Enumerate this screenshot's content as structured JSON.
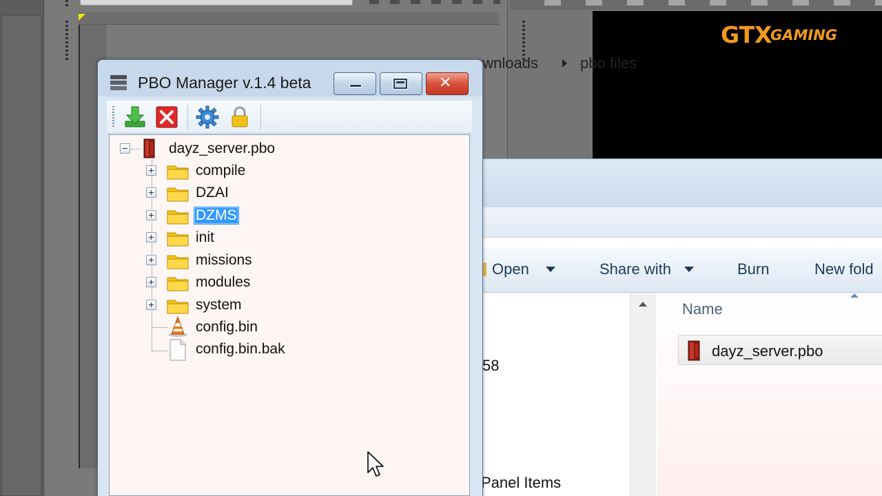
{
  "brand": {
    "logo_main": "GTX",
    "logo_sub": "GAMING",
    "color": "#f29a1c"
  },
  "explorer": {
    "breadcrumb": [
      "ownloads",
      "pbo files"
    ],
    "toolbar": [
      {
        "label": "Open",
        "has_dropdown": true
      },
      {
        "label": "Share with",
        "has_dropdown": true
      },
      {
        "label": "Burn",
        "has_dropdown": false
      },
      {
        "label": "New fold",
        "has_dropdown": false
      }
    ],
    "nav_fragments": [
      "58",
      "Panel Items"
    ],
    "column_header": "Name",
    "files": [
      {
        "name": "dayz_server.pbo",
        "icon": "pbo-file-icon"
      }
    ]
  },
  "pbo_manager": {
    "title": "PBO Manager v.1.4 beta",
    "window_buttons": [
      "minimize",
      "maximize",
      "close"
    ],
    "toolbar": [
      {
        "name": "extract",
        "icon": "green-download-arrow-icon"
      },
      {
        "name": "close",
        "icon": "red-x-icon"
      },
      {
        "name": "settings",
        "icon": "gear-icon"
      },
      {
        "name": "lock",
        "icon": "padlock-icon"
      }
    ],
    "tree": {
      "root": {
        "label": "dayz_server.pbo",
        "expanded": true
      },
      "children": [
        {
          "label": "compile",
          "type": "folder",
          "selected": false
        },
        {
          "label": "DZAI",
          "type": "folder",
          "selected": false
        },
        {
          "label": "DZMS",
          "type": "folder",
          "selected": true
        },
        {
          "label": "init",
          "type": "folder",
          "selected": false
        },
        {
          "label": "missions",
          "type": "folder",
          "selected": false
        },
        {
          "label": "modules",
          "type": "folder",
          "selected": false
        },
        {
          "label": "system",
          "type": "folder",
          "selected": false
        },
        {
          "label": "config.bin",
          "type": "file-cone",
          "selected": false
        },
        {
          "label": "config.bin.bak",
          "type": "file",
          "selected": false
        }
      ]
    },
    "selection_color": "#3399ff"
  }
}
